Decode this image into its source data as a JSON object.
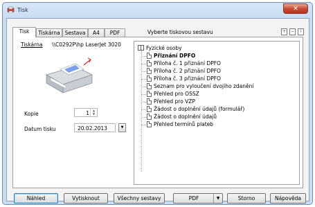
{
  "window": {
    "title": "Tisk",
    "close_label": "✕"
  },
  "tabs": [
    {
      "label": "Tisk",
      "active": true
    },
    {
      "label": "Tiskárna",
      "active": false
    },
    {
      "label": "Sestava",
      "active": false
    },
    {
      "label": "A4",
      "active": false
    },
    {
      "label": "PDF",
      "active": false
    }
  ],
  "tab_hint": "Vyberte tiskovou sestavu",
  "toolbar_icons": [
    "add-icon",
    "remove-icon",
    "info-icon"
  ],
  "printer": {
    "label": "Tiskárna",
    "name": "\\\\C0292P\\hp LaserJet 3020"
  },
  "copies": {
    "label": "Kopie",
    "value": "1"
  },
  "print_date": {
    "label": "Datum tisku",
    "value": "20.02.2013"
  },
  "tree": {
    "root": "Fyzické osoby",
    "items": [
      {
        "label": "Přiznání DPFO",
        "bold": true
      },
      {
        "label": "Příloha č. 1 přiznání DPFO",
        "bold": false
      },
      {
        "label": "Příloha č. 2 přiznání DPFO",
        "bold": false
      },
      {
        "label": "Příloha č. 3 přiznání DPFO",
        "bold": false
      },
      {
        "label": "Seznam pro vyloučení dvojího zdanění",
        "bold": false
      },
      {
        "label": "Přehled pro OSSZ",
        "bold": false
      },
      {
        "label": "Přehled pro VZP",
        "bold": false
      },
      {
        "label": "Žádost o doplnění údajů (formulář)",
        "bold": false
      },
      {
        "label": "Žádost o doplnění údajů",
        "bold": false
      },
      {
        "label": "Přehled termínů plateb",
        "bold": false
      }
    ]
  },
  "buttons": {
    "preview": "Náhled",
    "print": "Vytisknout",
    "all_reports": "Všechny sestavy",
    "pdf": "PDF",
    "cancel": "Storno",
    "help": "Nápověda"
  },
  "colors": {
    "title_bar": "#c9dcf2",
    "close_button": "#c94a33",
    "default_button_border": "#3c7fb1"
  }
}
